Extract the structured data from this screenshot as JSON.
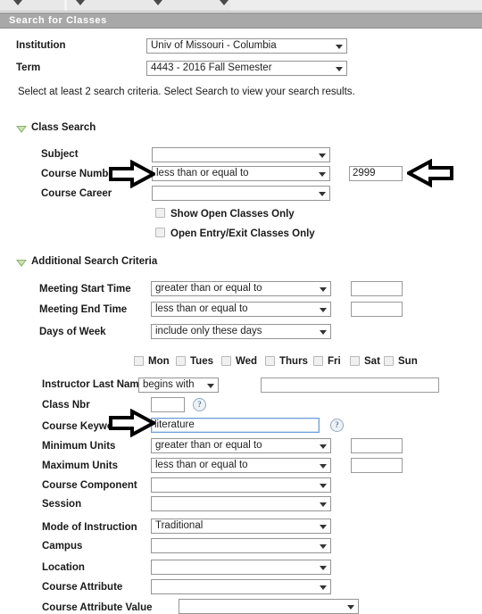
{
  "nav": {
    "caret_icon": "chevron-down-icon",
    "caret_count": 4
  },
  "header": {
    "title": "Search for Classes"
  },
  "top_form": {
    "institution": {
      "label": "Institution",
      "value": "Univ of Missouri - Columbia"
    },
    "term": {
      "label": "Term",
      "value": "4443 - 2016 Fall Semester"
    }
  },
  "instructions": "Select at least 2 search criteria. Select Search to view your search results.",
  "class_search": {
    "section_title": "Class Search",
    "subject": {
      "label": "Subject",
      "value": ""
    },
    "course_number": {
      "label": "Course Number",
      "operator": "less than or equal to",
      "value": "2999"
    },
    "course_career": {
      "label": "Course Career",
      "value": ""
    },
    "checkboxes": [
      {
        "label": "Show Open Classes Only",
        "checked": false
      },
      {
        "label": "Open Entry/Exit Classes Only",
        "checked": false
      }
    ]
  },
  "additional_criteria": {
    "section_title": "Additional Search Criteria",
    "meeting_start_time": {
      "label": "Meeting Start Time",
      "operator": "greater than or equal to",
      "value": ""
    },
    "meeting_end_time": {
      "label": "Meeting End Time",
      "operator": "less than or equal to",
      "value": ""
    },
    "days_of_week": {
      "label": "Days of Week",
      "operator": "include only these days",
      "days": [
        {
          "label": "Mon",
          "checked": false
        },
        {
          "label": "Tues",
          "checked": false
        },
        {
          "label": "Wed",
          "checked": false
        },
        {
          "label": "Thurs",
          "checked": false
        },
        {
          "label": "Fri",
          "checked": false
        },
        {
          "label": "Sat",
          "checked": false
        },
        {
          "label": "Sun",
          "checked": false
        }
      ]
    },
    "instructor_last_name": {
      "label": "Instructor Last Name",
      "operator": "begins with",
      "value": ""
    },
    "class_nbr": {
      "label": "Class Nbr",
      "value": "",
      "help_glyph": "?"
    },
    "course_keyword": {
      "label": "Course Keyword",
      "value": "literature",
      "help_glyph": "?"
    },
    "minimum_units": {
      "label": "Minimum Units",
      "operator": "greater than or equal to",
      "value": ""
    },
    "maximum_units": {
      "label": "Maximum Units",
      "operator": "less than or equal to",
      "value": ""
    },
    "course_component": {
      "label": "Course Component",
      "value": ""
    },
    "session": {
      "label": "Session",
      "value": ""
    },
    "mode_of_instruction": {
      "label": "Mode of Instruction",
      "value": "Traditional"
    },
    "campus": {
      "label": "Campus",
      "value": ""
    },
    "location": {
      "label": "Location",
      "value": ""
    },
    "course_attribute": {
      "label": "Course Attribute",
      "value": ""
    },
    "course_attribute_value": {
      "label": "Course Attribute Value",
      "value": ""
    }
  },
  "annotations": [
    {
      "name": "arrow-right-course-number",
      "direction": "right"
    },
    {
      "name": "arrow-left-course-number-value",
      "direction": "left"
    },
    {
      "name": "arrow-right-course-keyword",
      "direction": "right"
    }
  ],
  "colors": {
    "header_bar": "#a8a8a8",
    "header_text": "#ffffff",
    "section_triangle": "#8ab56b",
    "focus_border": "#6f9fd8",
    "help_icon": "#5d7f9e"
  }
}
